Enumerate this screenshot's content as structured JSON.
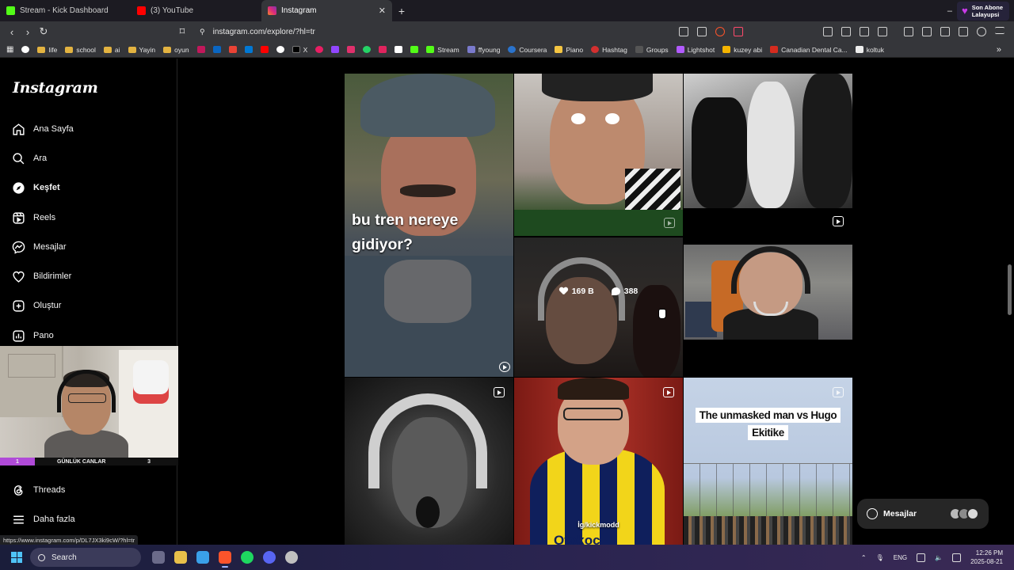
{
  "browser": {
    "tabs": [
      {
        "label": "Stream - Kick Dashboard",
        "color": "#53fc18"
      },
      {
        "label": "(3) YouTube",
        "color": "#ff0000"
      },
      {
        "label": "Instagram",
        "color": "#e1306c"
      }
    ],
    "new_tab_label": "+",
    "close_tab_label": "✕",
    "promo": {
      "line1": "Son Abone",
      "line2": "Lalayupsi"
    },
    "url": "instagram.com/explore/?hl=tr",
    "bookmarks": [
      {
        "label": "life",
        "type": "folder"
      },
      {
        "label": "school",
        "type": "folder"
      },
      {
        "label": "ai",
        "type": "folder"
      },
      {
        "label": "Yayin",
        "type": "folder"
      },
      {
        "label": "oyun",
        "type": "folder"
      },
      {
        "label": "X",
        "type": "site"
      },
      {
        "label": "Stream",
        "type": "site"
      },
      {
        "label": "ffyoung",
        "type": "site"
      },
      {
        "label": "Coursera",
        "type": "site"
      },
      {
        "label": "Piano",
        "type": "site"
      },
      {
        "label": "Hashtag",
        "type": "site"
      },
      {
        "label": "Groups",
        "type": "site"
      },
      {
        "label": "Lightshot",
        "type": "site"
      },
      {
        "label": "kuzey abi",
        "type": "site"
      },
      {
        "label": "Canadian Dental Ca...",
        "type": "site"
      },
      {
        "label": "koltuk",
        "type": "site"
      }
    ]
  },
  "instagram": {
    "logo": "Instagram",
    "nav": [
      {
        "label": "Ana Sayfa",
        "icon": "home-icon"
      },
      {
        "label": "Ara",
        "icon": "search-icon"
      },
      {
        "label": "Keşfet",
        "icon": "compass-icon"
      },
      {
        "label": "Reels",
        "icon": "reels-icon"
      },
      {
        "label": "Mesajlar",
        "icon": "messenger-icon"
      },
      {
        "label": "Bildirimler",
        "icon": "heart-icon"
      },
      {
        "label": "Oluştur",
        "icon": "plus-square-icon"
      },
      {
        "label": "Pano",
        "icon": "dashboard-icon"
      },
      {
        "label": "Threads",
        "icon": "threads-icon"
      },
      {
        "label": "Daha fazla",
        "icon": "menu-icon"
      }
    ],
    "posts": {
      "tren_caption_line1": "bu tren nereye",
      "tren_caption_line2": "gidiyor?",
      "hover_likes": "169 B",
      "hover_comments": "388",
      "kickmodd_tag": "İg/kickmodd",
      "kickmodd_big": "Otokoc",
      "hugo_line1": "The unmasked man vs Hugo",
      "hugo_line2": "Ekitike"
    },
    "messages_label": "Mesajlar",
    "status_link": "https://www.instagram.com/p/DL7JX3ki9cW/?hl=tr"
  },
  "webcam": {
    "rank": "1",
    "name": "GÜNLÜK CANLAR",
    "count": "3"
  },
  "taskbar": {
    "search_label": "Search",
    "lang": "ENG",
    "time": "12:26 PM",
    "date": "2025-08-21"
  }
}
